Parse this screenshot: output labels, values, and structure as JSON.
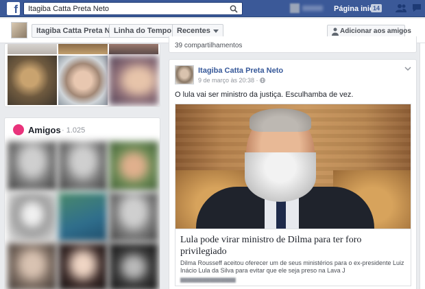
{
  "topbar": {
    "search_value": "Itagiba Catta Preta Neto",
    "home_label": "Página inicial",
    "home_badge": "14",
    "logo_letter": "f",
    "icons": [
      "search-icon",
      "friend-requests-icon",
      "messages-icon"
    ]
  },
  "timeline": {
    "profile_name": "Itagiba Catta Preta Neto",
    "timeline_label": "Linha do Tempo",
    "recent_label": "Recentes",
    "add_friend_label": "Adicionar aos amigos"
  },
  "friends": {
    "title": "Amigos",
    "count": "· 1.025"
  },
  "feed": {
    "prev_shares": "39 compartilhamentos",
    "post": {
      "author": "Itagiba Catta Preta Neto",
      "time": "9 de março às 20:38 · ",
      "text": "O lula vai ser ministro da justiça. Esculhamba de vez.",
      "link_title": "Lula pode virar ministro de Dilma para ter foro privilegiado",
      "link_desc": "Dilma Rousseff aceitou oferecer um de seus ministérios para o ex-presidente Luiz Inácio Lula da Silva para evitar que ele seja preso na Lava J"
    }
  },
  "colors": {
    "brand": "#3b5998",
    "link": "#365899",
    "friends_accent": "#e9337b"
  }
}
